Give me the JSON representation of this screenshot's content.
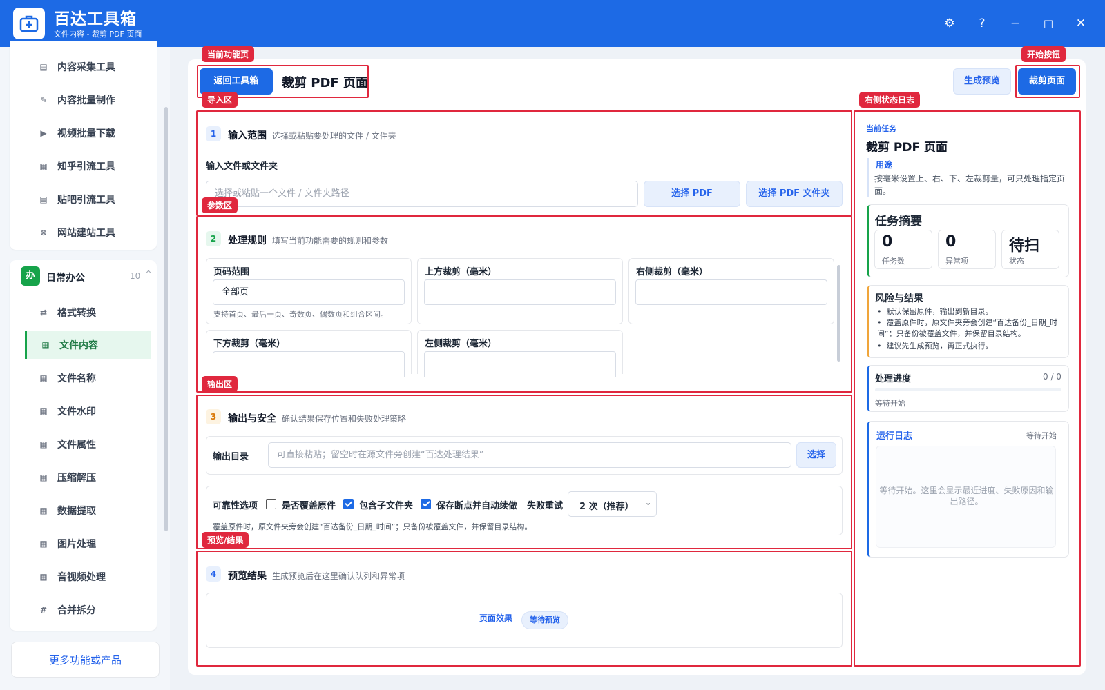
{
  "app": {
    "title": "百达工具箱",
    "subtitle": "文件内容 - 裁剪 PDF 页面"
  },
  "window_controls": {
    "settings": "⚙",
    "help": "?",
    "minimize": "−",
    "maximize": "□",
    "close": "✕"
  },
  "sidebar": {
    "items_top": [
      {
        "label": "内容采集工具",
        "icon": "clipboard-icon"
      },
      {
        "label": "内容批量制作",
        "icon": "pencil-icon"
      },
      {
        "label": "视频批量下载",
        "icon": "video-icon"
      },
      {
        "label": "知乎引流工具",
        "icon": "zhihu-icon"
      },
      {
        "label": "贴吧引流工具",
        "icon": "tieba-icon"
      },
      {
        "label": "网站建站工具",
        "icon": "globe-icon"
      }
    ],
    "group": {
      "badge": "办",
      "title": "日常办公",
      "count": "10",
      "chevron": "^"
    },
    "group_items": [
      {
        "label": "格式转换",
        "icon": "swap-icon"
      },
      {
        "label": "文件内容",
        "icon": "grid-icon",
        "active": true
      },
      {
        "label": "文件名称",
        "icon": "grid-icon"
      },
      {
        "label": "文件水印",
        "icon": "grid-icon"
      },
      {
        "label": "文件属性",
        "icon": "grid-icon"
      },
      {
        "label": "压缩解压",
        "icon": "grid-icon"
      },
      {
        "label": "数据提取",
        "icon": "grid-icon"
      },
      {
        "label": "图片处理",
        "icon": "grid-icon"
      },
      {
        "label": "音视频处理",
        "icon": "grid-icon"
      },
      {
        "label": "合并拆分",
        "icon": "hash-icon"
      }
    ],
    "more_button": "更多功能或产品"
  },
  "annotations": {
    "current_page": "当前功能页",
    "start_button": "开始按钮",
    "import_area": "导入区",
    "right_log": "右侧状态日志",
    "params_area": "参数区",
    "output_area": "输出区",
    "preview_area": "预览/结果"
  },
  "header": {
    "back_button": "返回工具箱",
    "page_title": "裁剪 PDF 页面",
    "preview_button": "生成预览",
    "run_button": "裁剪页面"
  },
  "section1": {
    "num": "1",
    "title": "输入范围",
    "desc": "选择或粘贴要处理的文件 / 文件夹",
    "field_label": "输入文件或文件夹",
    "placeholder": "选择或粘贴一个文件 / 文件夹路径",
    "btn_pdf": "选择 PDF",
    "btn_folder": "选择 PDF 文件夹"
  },
  "section2": {
    "num": "2",
    "title": "处理规则",
    "desc": "填写当前功能需要的规则和参数",
    "fields": {
      "page_range": {
        "label": "页码范围",
        "value": "全部页",
        "hint": "支持首页、最后一页、奇数页、偶数页和组合区间。"
      },
      "top": {
        "label": "上方裁剪（毫米）",
        "value": ""
      },
      "right": {
        "label": "右侧裁剪（毫米）",
        "value": ""
      },
      "bottom": {
        "label": "下方裁剪（毫米）",
        "value": ""
      },
      "left": {
        "label": "左侧裁剪（毫米）",
        "value": ""
      }
    }
  },
  "section3": {
    "num": "3",
    "title": "输出与安全",
    "desc": "确认结果保存位置和失败处理策略",
    "output_label": "输出目录",
    "output_placeholder": "可直接粘贴；留空时在源文件旁创建“百达处理结果”",
    "choose": "选择",
    "reliability_label": "可靠性选项",
    "overwrite": {
      "label": "是否覆盖原件",
      "checked": false
    },
    "subfolders": {
      "label": "包含子文件夹",
      "checked": true
    },
    "resume": {
      "label": "保存断点并自动续做",
      "checked": true
    },
    "retry_label": "失败重试",
    "retry_value": "2 次（推荐）",
    "note": "覆盖原件时，原文件夹旁会创建“百达备份_日期_时间”；只备份被覆盖文件，并保留目录结构。"
  },
  "section4": {
    "num": "4",
    "title": "预览结果",
    "desc": "生成预览后在这里确认队列和异常项",
    "effect_label": "页面效果",
    "status_pill": "等待预览"
  },
  "right_panel": {
    "task_caption": "当前任务",
    "task_title": "裁剪 PDF 页面",
    "purpose_label": "用途",
    "purpose_text": "按毫米设置上、右、下、左裁剪量，可只处理指定页面。",
    "summary_title": "任务摘要",
    "stats": [
      {
        "value": "0",
        "label": "任务数"
      },
      {
        "value": "0",
        "label": "异常项"
      },
      {
        "value": "待扫",
        "label": "状态"
      }
    ],
    "risk_title": "风险与结果",
    "risk_items": [
      "默认保留原件，输出到新目录。",
      "覆盖原件时，原文件夹旁会创建“百达备份_日期_时间”；只备份被覆盖文件，并保留目录结构。",
      "建议先生成预览，再正式执行。"
    ],
    "progress_title": "处理进度",
    "progress_count": "0 / 0",
    "progress_fraction": 0,
    "progress_status": "等待开始",
    "log_title": "运行日志",
    "log_status": "等待开始",
    "log_placeholder": "等待开始。这里会显示最近进度、失败原因和输出路径。"
  },
  "colors": {
    "brand": "#1d6ae5",
    "annotation": "#e0283e",
    "active_green": "#16a34a"
  }
}
